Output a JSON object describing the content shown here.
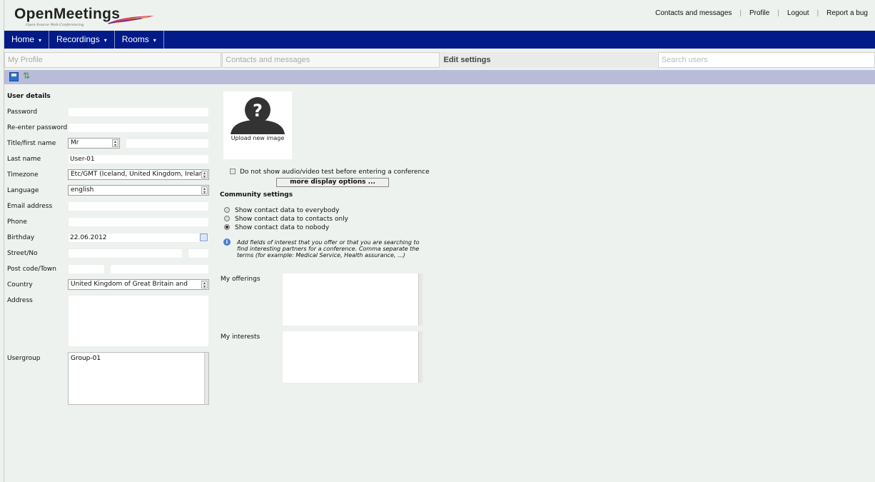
{
  "app": {
    "logo_text": "OpenMeetings",
    "logo_tagline": "Open-Source Web-Conferencing"
  },
  "toplinks": {
    "contacts": "Contacts and messages",
    "profile": "Profile",
    "logout": "Logout",
    "report_bug": "Report a bug",
    "separator": "|"
  },
  "menu": {
    "home": "Home",
    "recordings": "Recordings",
    "rooms": "Rooms",
    "caret": "▾"
  },
  "tabs": {
    "my_profile": "My Profile",
    "contacts": "Contacts and messages",
    "edit_settings": "Edit settings",
    "search_users": "Search users"
  },
  "form": {
    "section_title": "User details",
    "labels": {
      "password": "Password",
      "reenter": "Re-enter password",
      "title_first": "Title/first name",
      "last_name": "Last name",
      "timezone": "Timezone",
      "language": "Language",
      "email": "Email address",
      "phone": "Phone",
      "birthday": "Birthday",
      "street": "Street/No",
      "postcode": "Post code/Town",
      "country": "Country",
      "address": "Address",
      "usergroup": "Usergroup"
    },
    "values": {
      "title": "Mr",
      "last_name": "User-01",
      "timezone": "Etc/GMT (Iceland, United Kingdom, Irelanc",
      "language": "english",
      "birthday": "22.06.2012",
      "country": "United Kingdom of Great Britain and Northe",
      "usergroup": "Group-01"
    }
  },
  "photo": {
    "upload_label": "Upload new image"
  },
  "display": {
    "av_test_label": "Do not show audio/video test before entering a conference",
    "av_test_checked": false,
    "more_options": "more display options ..."
  },
  "community": {
    "title": "Community settings",
    "options": [
      "Show contact data to everybody",
      "Show contact data to contacts only",
      "Show contact data to nobody"
    ],
    "selected_index": 2,
    "info_text": "Add fields of interest that you offer or that you are searching to find interesting partners for a conference. Comma separate the terms (for example: Medical Service, Health assurance, ...)",
    "offerings_label": "My offerings",
    "interests_label": "My interests"
  }
}
